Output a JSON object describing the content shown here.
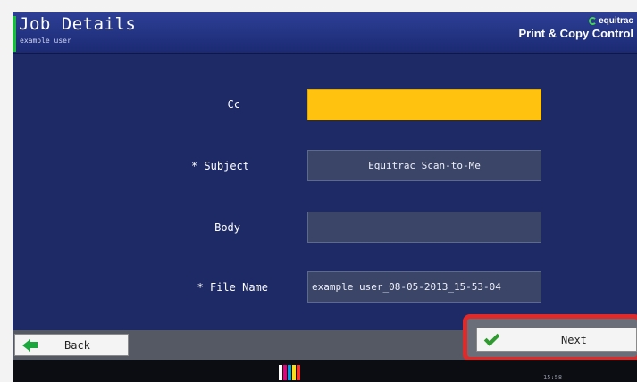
{
  "header": {
    "title": "Job Details",
    "user": "example user",
    "brand_logo": "equitrac",
    "brand_name": "Print & Copy Control"
  },
  "form": {
    "fields": [
      {
        "label": "Cc",
        "value": "",
        "state": "focused"
      },
      {
        "label": "* Subject",
        "value": "Equitrac Scan-to-Me"
      },
      {
        "label": "Body",
        "value": ""
      },
      {
        "label": "* File Name",
        "value": "example user_08-05-2013_15-53-04"
      }
    ]
  },
  "footer": {
    "back_label": "Back",
    "next_label": "Next",
    "time": "15:58"
  },
  "colors": {
    "background": "#1e2a66",
    "focused_field": "#ffc20e",
    "highlight_border": "#e02a2a",
    "accent": "#1fb840",
    "ink_levels": [
      "#ffffff",
      "#e6007e",
      "#00a0e0",
      "#ffe000",
      "#222222"
    ]
  }
}
